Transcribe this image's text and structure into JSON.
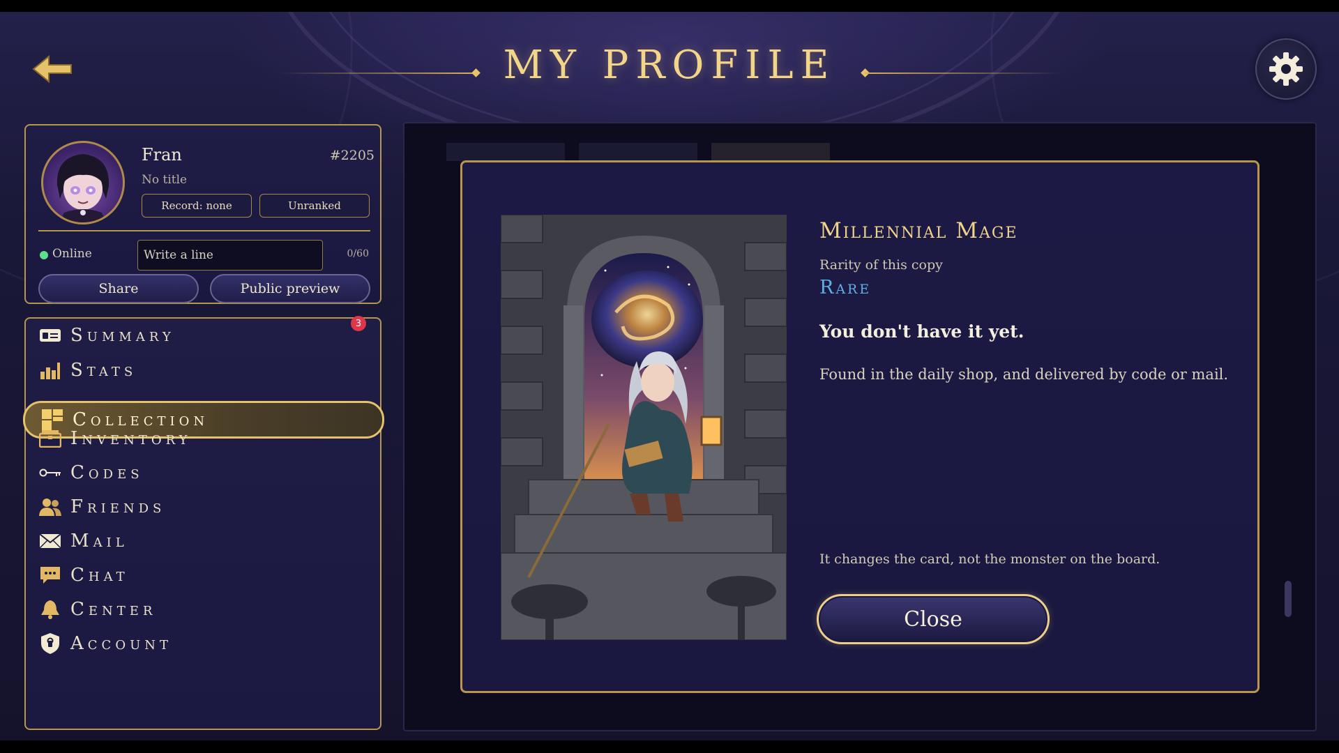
{
  "header": {
    "title": "MY PROFILE"
  },
  "profile": {
    "name": "Fran",
    "tag": "#2205",
    "title": "No title",
    "record": "Record: none",
    "rank": "Unranked",
    "status": "Online",
    "line_placeholder": "Write a line",
    "line_count": "0/60",
    "share_label": "Share",
    "preview_label": "Public preview"
  },
  "nav": {
    "items": [
      {
        "label": "Summary",
        "icon": "id-card-icon",
        "badge": "3"
      },
      {
        "label": "Stats",
        "icon": "bar-chart-icon"
      },
      {
        "label": "Collection",
        "icon": "collection-grid-icon",
        "active": true
      },
      {
        "label": "Inventory",
        "icon": "chest-icon"
      },
      {
        "label": "Codes",
        "icon": "key-icon"
      },
      {
        "label": "Friends",
        "icon": "friends-icon"
      },
      {
        "label": "Mail",
        "icon": "mail-icon"
      },
      {
        "label": "Chat",
        "icon": "chat-icon"
      },
      {
        "label": "Center",
        "icon": "bell-icon"
      },
      {
        "label": "Account",
        "icon": "shield-icon"
      }
    ]
  },
  "modal": {
    "card_name": "Millennial Mage",
    "rarity_label": "Rarity of this copy",
    "rarity_value": "Rare",
    "status": "You don't have it yet.",
    "description": "Found in the daily shop, and delivered by code or mail.",
    "note": "It changes the card, not the monster on the board.",
    "close_label": "Close"
  },
  "colors": {
    "accent_gold": "#d6b25a",
    "rarity_rare": "#5fb0e6",
    "badge_red": "#e0364a",
    "online_green": "#5ee08a"
  }
}
